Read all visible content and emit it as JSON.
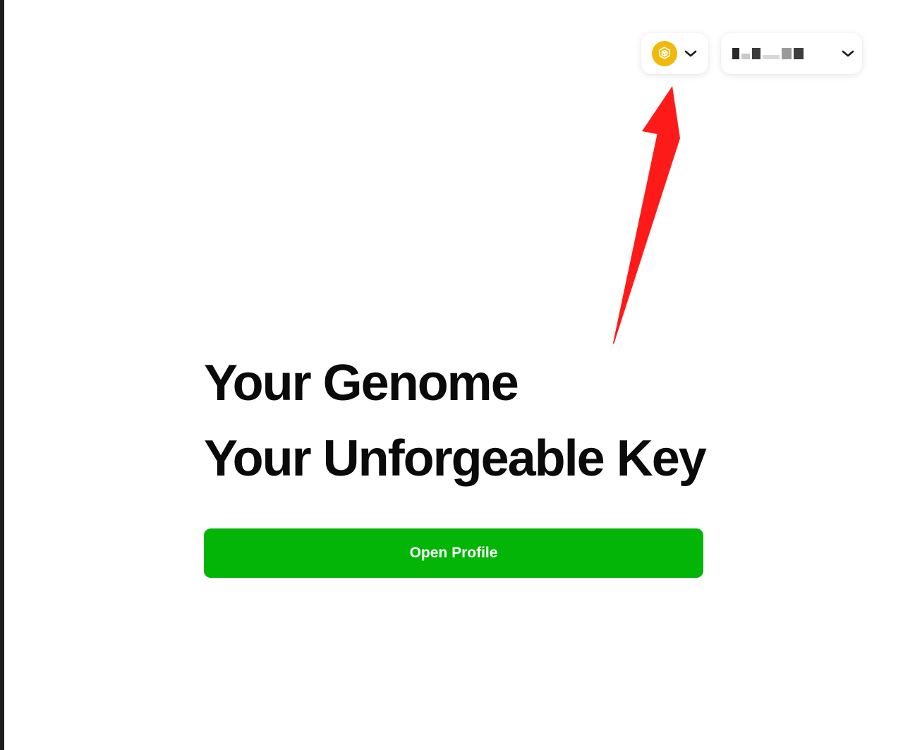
{
  "header": {
    "network_selector": {
      "icon": "bnb-chain-icon",
      "accent_color": "#f0b90b",
      "chevron": "chevron-down-icon"
    },
    "account_selector": {
      "label": "",
      "chevron": "chevron-down-icon"
    }
  },
  "hero": {
    "line1": "Your Genome",
    "line2": "Your Unforgeable Key"
  },
  "cta": {
    "label": "Open Profile",
    "color": "#02b507"
  },
  "annotation": {
    "icon": "red-arrow-icon",
    "color": "#ff1a1a"
  }
}
